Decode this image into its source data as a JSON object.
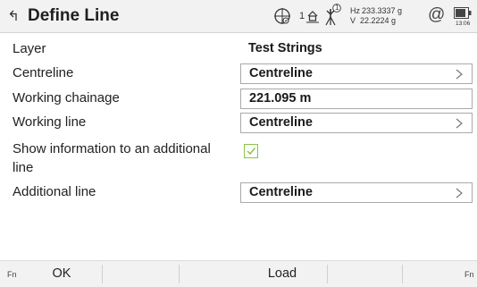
{
  "header": {
    "title": "Define Line",
    "hz_label": "Hz",
    "hz_value": "233.3337 g",
    "v_label": "V",
    "v_value": "22.2224 g",
    "target_number": "1",
    "prism_number": "1",
    "battery_time": "13:06",
    "at_symbol": "@"
  },
  "form": {
    "layer": {
      "label": "Layer",
      "value": "Test Strings"
    },
    "centreline": {
      "label": "Centreline",
      "value": "Centreline"
    },
    "working_chainage": {
      "label": "Working chainage",
      "value": "221.095 m"
    },
    "working_line": {
      "label": "Working line",
      "value": "Centreline"
    },
    "show_info": {
      "label_line1": "Show information to an additional",
      "label_line2": "line",
      "checked": true
    },
    "additional_line": {
      "label": "Additional line",
      "value": "Centreline"
    }
  },
  "footer": {
    "fn_left": "Fn",
    "ok_label": "OK",
    "load_label": "Load",
    "fn_right": "Fn"
  },
  "colors": {
    "checkbox_accent": "#8bc34a",
    "titlebar_bg": "#f2f2f2"
  }
}
